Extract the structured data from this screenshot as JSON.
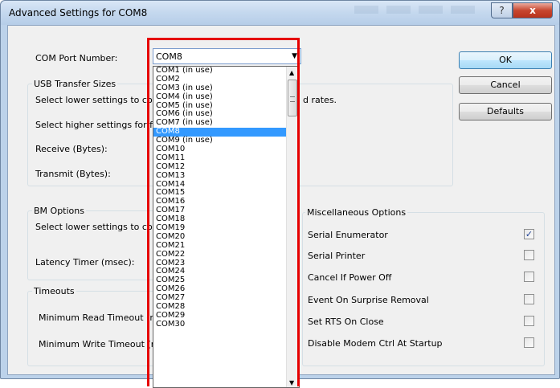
{
  "window": {
    "title": "Advanced Settings for COM8",
    "help_label": "?",
    "close_label": "x"
  },
  "com_port": {
    "label": "COM Port Number:",
    "selected": "COM8"
  },
  "buttons": {
    "ok": "OK",
    "cancel": "Cancel",
    "defaults": "Defaults"
  },
  "usb_transfer": {
    "legend": "USB Transfer Sizes",
    "line1_prefix": "Select lower settings to corre",
    "line1_suffix": "d rates.",
    "line2_prefix": "Select higher settings for fas",
    "receive_label": "Receive (Bytes):",
    "transmit_label": "Transmit (Bytes):"
  },
  "bm_options": {
    "legend": "BM Options",
    "line1_prefix": "Select lower settings to corre",
    "latency_label": "Latency Timer (msec):"
  },
  "timeouts": {
    "legend": "Timeouts",
    "read_label": "Minimum Read Timeout (mse",
    "write_label": "Minimum Write Timeout (mse"
  },
  "misc": {
    "legend": "Miscellaneous Options",
    "options": [
      {
        "label": "Serial Enumerator",
        "checked": true
      },
      {
        "label": "Serial Printer",
        "checked": false
      },
      {
        "label": "Cancel If Power Off",
        "checked": false
      },
      {
        "label": "Event On Surprise Removal",
        "checked": false
      },
      {
        "label": "Set RTS On Close",
        "checked": false
      },
      {
        "label": "Disable Modem Ctrl At Startup",
        "checked": false
      }
    ]
  },
  "dropdown": {
    "selected_index": 7,
    "items": [
      "COM1 (in use)",
      "COM2",
      "COM3 (in use)",
      "COM4 (in use)",
      "COM5 (in use)",
      "COM6 (in use)",
      "COM7 (in use)",
      "COM8",
      "COM9 (in use)",
      "COM10",
      "COM11",
      "COM12",
      "COM13",
      "COM14",
      "COM15",
      "COM16",
      "COM17",
      "COM18",
      "COM19",
      "COM20",
      "COM21",
      "COM22",
      "COM23",
      "COM24",
      "COM25",
      "COM26",
      "COM27",
      "COM28",
      "COM29",
      "COM30"
    ]
  },
  "colors": {
    "highlight": "#e60000",
    "selection": "#3399ff"
  }
}
